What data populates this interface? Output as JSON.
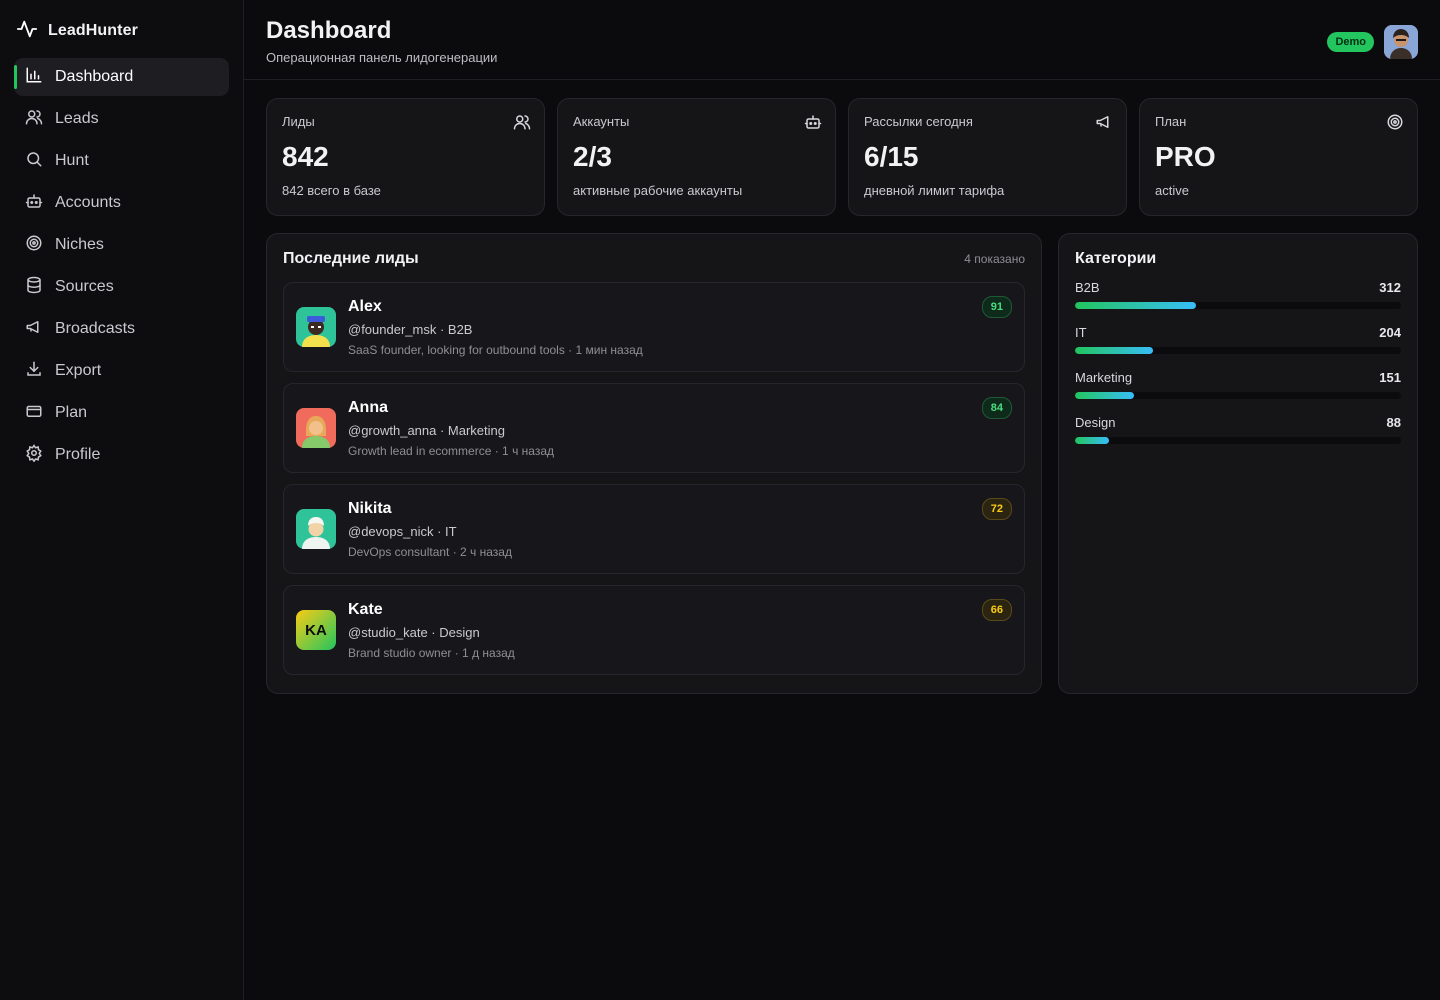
{
  "brand": {
    "name": "LeadHunter"
  },
  "nav": [
    {
      "label": "Dashboard",
      "icon": "bar-chart-icon",
      "active": true
    },
    {
      "label": "Leads",
      "icon": "users-icon"
    },
    {
      "label": "Hunt",
      "icon": "search-icon"
    },
    {
      "label": "Accounts",
      "icon": "bot-icon"
    },
    {
      "label": "Niches",
      "icon": "target-icon"
    },
    {
      "label": "Sources",
      "icon": "database-icon"
    },
    {
      "label": "Broadcasts",
      "icon": "megaphone-icon"
    },
    {
      "label": "Export",
      "icon": "download-icon"
    },
    {
      "label": "Plan",
      "icon": "credit-card-icon"
    },
    {
      "label": "Profile",
      "icon": "gear-icon"
    }
  ],
  "header": {
    "title": "Dashboard",
    "subtitle": "Операционная панель лидогенерации",
    "badge": "Demo"
  },
  "stats": [
    {
      "label": "Лиды",
      "value": "842",
      "sub": "842 всего в базе",
      "icon": "users-icon"
    },
    {
      "label": "Аккаунты",
      "value": "2/3",
      "sub": "активные рабочие аккаунты",
      "icon": "bot-icon"
    },
    {
      "label": "Рассылки сегодня",
      "value": "6/15",
      "sub": "дневной лимит тарифа",
      "icon": "megaphone-icon"
    },
    {
      "label": "План",
      "value": "PRO",
      "sub": "active",
      "icon": "target-icon"
    }
  ],
  "leads_panel": {
    "title": "Последние лиды",
    "meta": "4 показано",
    "items": [
      {
        "name": "Alex",
        "handle": "@founder_msk · B2B",
        "desc": "SaaS founder, looking for outbound tools · 1 мин назад",
        "score": "91",
        "score_tone": "green",
        "avatar": "avatar-alex"
      },
      {
        "name": "Anna",
        "handle": "@growth_anna · Marketing",
        "desc": "Growth lead in ecommerce · 1 ч назад",
        "score": "84",
        "score_tone": "green",
        "avatar": "avatar-anna"
      },
      {
        "name": "Nikita",
        "handle": "@devops_nick · IT",
        "desc": "DevOps consultant · 2 ч назад",
        "score": "72",
        "score_tone": "yellow",
        "avatar": "avatar-nikita"
      },
      {
        "name": "Kate",
        "handle": "@studio_kate · Design",
        "desc": "Brand studio owner · 1 д назад",
        "score": "66",
        "score_tone": "yellow",
        "avatar": "avatar-kate",
        "initials": "KA"
      }
    ]
  },
  "categories": {
    "title": "Категории",
    "items": [
      {
        "name": "B2B",
        "count": "312",
        "fill": 0.37
      },
      {
        "name": "IT",
        "count": "204",
        "fill": 0.24
      },
      {
        "name": "Marketing",
        "count": "151",
        "fill": 0.18
      },
      {
        "name": "Design",
        "count": "88",
        "fill": 0.105
      }
    ]
  },
  "colors": {
    "accent": "#22c55e",
    "bar_end": "#38bdf8",
    "background": "#0b0b0d",
    "card": "#151518"
  }
}
